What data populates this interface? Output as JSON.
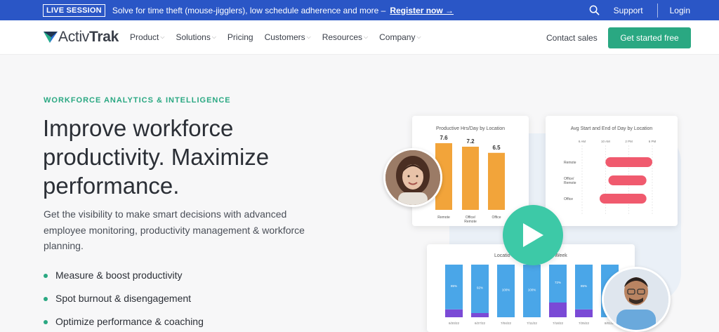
{
  "banner": {
    "badge": "LIVE SESSION",
    "text": "Solve for time theft (mouse-jigglers), low schedule adherence and more –",
    "register": "Register now →",
    "support": "Support",
    "login": "Login"
  },
  "nav": {
    "logo_prefix": "Activ",
    "logo_bold": "Trak",
    "items": [
      "Product",
      "Solutions",
      "Pricing",
      "Customers",
      "Resources",
      "Company"
    ],
    "contact": "Contact sales",
    "cta": "Get started free"
  },
  "hero": {
    "eyebrow": "WORKFORCE ANALYTICS & INTELLIGENCE",
    "headline": "Improve workforce productivity. Maximize performance.",
    "subtext": "Get the visibility to make smart decisions with advanced employee monitoring, productivity management & workforce planning.",
    "bullets": [
      "Measure & boost productivity",
      "Spot burnout & disengagement",
      "Optimize performance & coaching"
    ]
  },
  "colors": {
    "banner": "#2a56c6",
    "accent": "#2aa882",
    "play": "#3dc9a7",
    "bar_orange": "#f2a43a",
    "bar_pink": "#f05a6e",
    "bar_blue": "#4aa6e8",
    "bar_purple": "#7a4ad6"
  },
  "icons": {
    "search": "search-icon",
    "play": "play-icon",
    "logo_mark": "activtrak-logo-icon"
  },
  "chart_data": [
    {
      "type": "bar",
      "title": "Productive Hrs/Day by Location",
      "categories": [
        "Remote",
        "Office/ Remote",
        "Office"
      ],
      "values": [
        7.6,
        7.2,
        6.5
      ],
      "value_labels": [
        "7.6",
        "7.2",
        "6.5"
      ]
    },
    {
      "type": "bar",
      "title": "Avg Start and End of Day by Location",
      "orientation": "horizontal-range",
      "axis_ticks": [
        "6 AM",
        "10 AM",
        "2 PM",
        "6 PM"
      ],
      "categories": [
        "Remote",
        "Office/ Remote",
        "Office"
      ],
      "ranges": [
        [
          10,
          18
        ],
        [
          10.5,
          17
        ],
        [
          9,
          17
        ]
      ]
    },
    {
      "type": "bar",
      "stacked": true,
      "title_parts": [
        "Locatio",
        "Week"
      ],
      "categories": [
        "6/20/22",
        "6/27/22",
        "7/04/22",
        "7/11/22",
        "7/18/22",
        "7/25/22",
        "8/01/22"
      ],
      "value_labels": [
        "85%",
        "92%",
        "100%",
        "100%",
        "72%",
        "85%",
        "100%"
      ],
      "series": [
        {
          "values": [
            85,
            92,
            100,
            100,
            72,
            85,
            100
          ]
        },
        {
          "values": [
            15,
            8,
            0,
            0,
            28,
            15,
            0
          ]
        }
      ]
    }
  ]
}
